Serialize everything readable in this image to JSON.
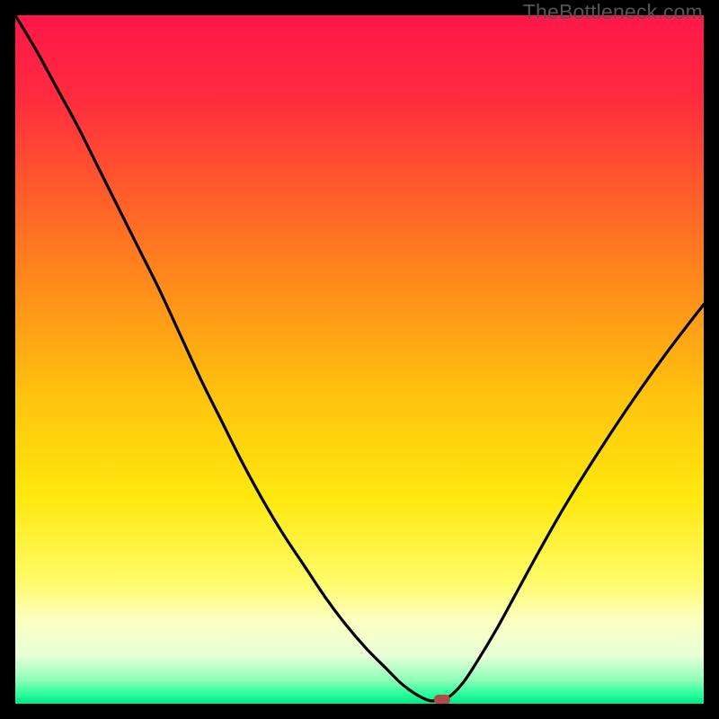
{
  "attribution": "TheBottleneck.com",
  "chart_data": {
    "type": "line",
    "title": "",
    "xlabel": "",
    "ylabel": "",
    "xlim": [
      0,
      100
    ],
    "ylim": [
      0,
      100
    ],
    "gradient_stops": [
      {
        "offset": 0.0,
        "color": "#ff1749"
      },
      {
        "offset": 0.12,
        "color": "#ff2b3f"
      },
      {
        "offset": 0.25,
        "color": "#ff5a2c"
      },
      {
        "offset": 0.4,
        "color": "#ff8e1a"
      },
      {
        "offset": 0.55,
        "color": "#ffc20e"
      },
      {
        "offset": 0.7,
        "color": "#ffe80e"
      },
      {
        "offset": 0.82,
        "color": "#fffb66"
      },
      {
        "offset": 0.88,
        "color": "#fdffc2"
      },
      {
        "offset": 0.93,
        "color": "#e8ffd8"
      },
      {
        "offset": 0.965,
        "color": "#8fffb8"
      },
      {
        "offset": 0.985,
        "color": "#2fff9f"
      },
      {
        "offset": 1.0,
        "color": "#00e885"
      }
    ],
    "series": [
      {
        "name": "bottleneck-curve",
        "x": [
          0.0,
          3.0,
          6.0,
          9.0,
          12.0,
          15.0,
          18.0,
          21.0,
          24.0,
          27.0,
          30.0,
          33.0,
          36.0,
          39.0,
          42.0,
          45.0,
          48.0,
          51.0,
          54.0,
          56.0,
          58.0,
          60.0,
          61.5,
          63.0,
          65.0,
          67.0,
          70.0,
          73.0,
          76.0,
          80.0,
          85.0,
          90.0,
          95.0,
          100.0
        ],
        "y": [
          100.0,
          95.0,
          89.5,
          84.0,
          78.0,
          72.0,
          66.0,
          60.0,
          53.5,
          47.0,
          41.0,
          35.0,
          29.5,
          24.5,
          20.0,
          15.5,
          11.5,
          8.0,
          5.0,
          3.0,
          1.5,
          0.5,
          0.5,
          1.0,
          3.0,
          6.0,
          11.0,
          16.5,
          22.0,
          29.0,
          37.0,
          44.5,
          51.5,
          58.0
        ]
      }
    ],
    "marker": {
      "x": 62.0,
      "y": 0.6,
      "color": "#b24a4a"
    }
  }
}
